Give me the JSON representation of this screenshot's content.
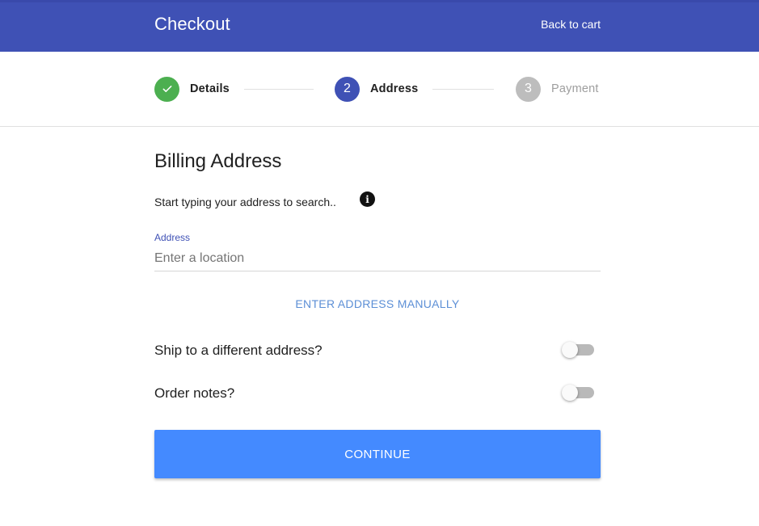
{
  "header": {
    "title": "Checkout",
    "back_link": "Back to cart",
    "color": "#3f51b5"
  },
  "stepper": {
    "steps": [
      {
        "number": "",
        "label": "Details",
        "state": "completed",
        "icon": "check-icon",
        "color": "#4caf50"
      },
      {
        "number": "2",
        "label": "Address",
        "state": "active",
        "color": "#3f51b5"
      },
      {
        "number": "3",
        "label": "Payment",
        "state": "inactive",
        "color": "#bdbdbd"
      }
    ]
  },
  "billing": {
    "title": "Billing Address",
    "hint": "Start typing your address to search..",
    "info_icon": "info-icon",
    "address_field": {
      "label": "Address",
      "value": "",
      "placeholder": "Enter a location"
    },
    "manual_button": "ENTER ADDRESS MANUALLY"
  },
  "options": {
    "ship_different": {
      "label": "Ship to a different address?",
      "checked": false
    },
    "order_notes": {
      "label": "Order notes?",
      "checked": false
    }
  },
  "continue_button": {
    "label": "CONTINUE",
    "color": "#448aff"
  }
}
